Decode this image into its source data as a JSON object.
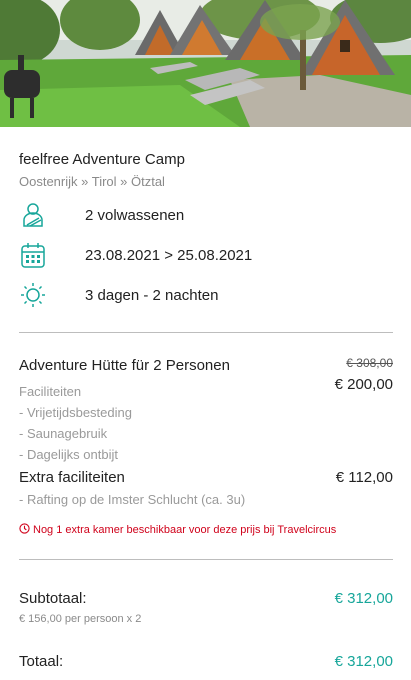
{
  "accommodation": {
    "name": "feelfree Adventure Camp",
    "breadcrumb": "Oostenrijk » Tirol » Ötztal"
  },
  "details": {
    "guests": {
      "icon": "person-icon",
      "text": "2 volwassenen"
    },
    "dates": {
      "icon": "calendar-icon",
      "text": "23.08.2021 > 25.08.2021"
    },
    "duration": {
      "icon": "sun-icon",
      "text": "3 dagen - 2 nachten"
    }
  },
  "room": {
    "title": "Adventure Hütte für 2 Personen",
    "old_price": "€ 308,00",
    "price": "€ 200,00",
    "facilities_label": "Faciliteiten",
    "facilities": [
      "- Vrijetijdsbesteding",
      "- Saunagebruik",
      "- Dagelijks ontbijt"
    ]
  },
  "extras": {
    "title": "Extra faciliteiten",
    "price": "€ 112,00",
    "items": [
      "- Rafting op de Imster Schlucht (ca. 3u)"
    ]
  },
  "availability_alert": "Nog 1 extra kamer beschikbaar voor deze prijs bij Travelcircus",
  "summary": {
    "subtotal_label": "Subtotaal:",
    "subtotal_value": "€ 312,00",
    "subtotal_note": "€ 156,00 per persoon x 2",
    "total_label": "Totaal:",
    "total_value": "€ 312,00"
  },
  "colors": {
    "accent": "#17a69a",
    "alert": "#d0021b"
  }
}
